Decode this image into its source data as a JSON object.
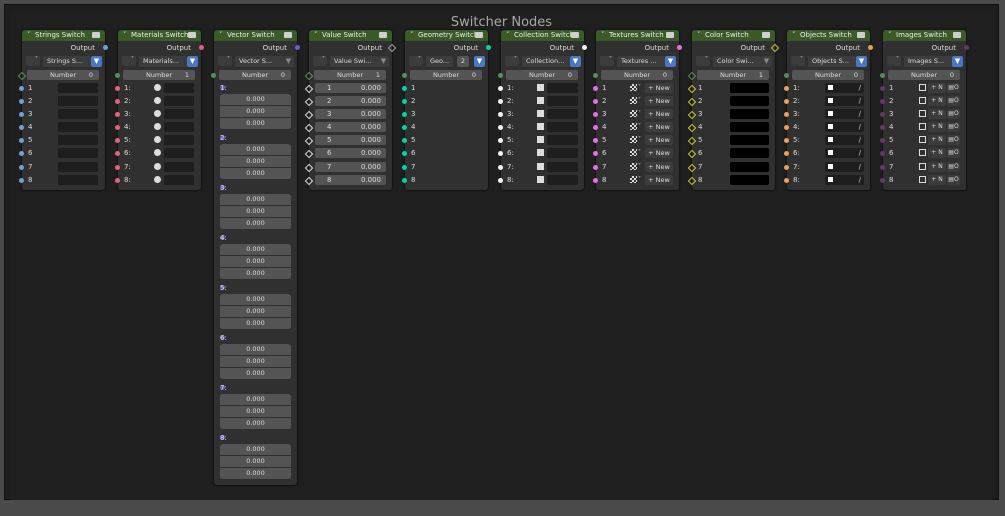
{
  "frame_title": "Switcher Nodes",
  "output_label": "Output",
  "number_label": "Number",
  "colors": {
    "header": "#3a5a27",
    "string": "#6fa0d8",
    "material": "#e3637c",
    "vector": "#6363c7",
    "value": "#a1a1a1",
    "geometry": "#00d6a3",
    "collection": "#f5f5f5",
    "texture": "#e66ee6",
    "color": "#c7c729",
    "object": "#ed9e5c",
    "image": "#633863",
    "int": "#598c5c"
  },
  "nodes": [
    {
      "title": "Strings Switch",
      "picker": "Strings S...",
      "number": "0",
      "shield": true,
      "inputs": [
        "1",
        "2",
        "3",
        "4",
        "5",
        "6",
        "7",
        "8"
      ]
    },
    {
      "title": "Materials Switch",
      "picker": "Materials...",
      "number": "1",
      "shield": true,
      "inputs": [
        "1:",
        "2:",
        "3:",
        "4:",
        "5:",
        "6:",
        "7:",
        "8:"
      ]
    },
    {
      "title": "Vector Switch",
      "picker": "Vector S...",
      "number": "0",
      "shield": false,
      "inputs": [
        "1:",
        "2:",
        "3:",
        "4:",
        "5:",
        "6:",
        "7:",
        "8:"
      ],
      "vector_value": "0.000"
    },
    {
      "title": "Value Switch",
      "picker": "Value Swi...",
      "number": "1",
      "shield": false,
      "inputs": [
        "1",
        "2",
        "3",
        "4",
        "5",
        "6",
        "7",
        "8"
      ],
      "value": "0.000"
    },
    {
      "title": "Geometry Switch",
      "picker": "Geo...",
      "users": "2",
      "number": "0",
      "shield": true,
      "inputs": [
        "1",
        "2",
        "3",
        "4",
        "5",
        "6",
        "7",
        "8"
      ]
    },
    {
      "title": "Collection Switch",
      "picker": "Collection...",
      "number": "0",
      "shield": true,
      "inputs": [
        "1:",
        "2:",
        "3:",
        "4:",
        "5:",
        "6:",
        "7:",
        "8:"
      ]
    },
    {
      "title": "Textures Switch",
      "picker": "Textures ...",
      "number": "0",
      "shield": true,
      "inputs": [
        "1",
        "2",
        "3",
        "4",
        "5",
        "6",
        "7",
        "8"
      ],
      "new_label": "+ New"
    },
    {
      "title": "Color Switch",
      "picker": "Color Swi...",
      "number": "1",
      "shield": false,
      "inputs": [
        "1",
        "2",
        "3",
        "4",
        "5",
        "6",
        "7",
        "8"
      ]
    },
    {
      "title": "Objects Switch",
      "picker": "Objects S...",
      "number": "0",
      "shield": true,
      "inputs": [
        "1:",
        "2:",
        "3:",
        "4:",
        "5:",
        "6:",
        "7:",
        "8:"
      ]
    },
    {
      "title": "Images Switch",
      "picker": "Images S...",
      "number": "0",
      "shield": true,
      "inputs": [
        "1",
        "2",
        "3",
        "4",
        "5",
        "6",
        "7",
        "8"
      ],
      "new_label": "+ N",
      "open_label": "O"
    }
  ]
}
